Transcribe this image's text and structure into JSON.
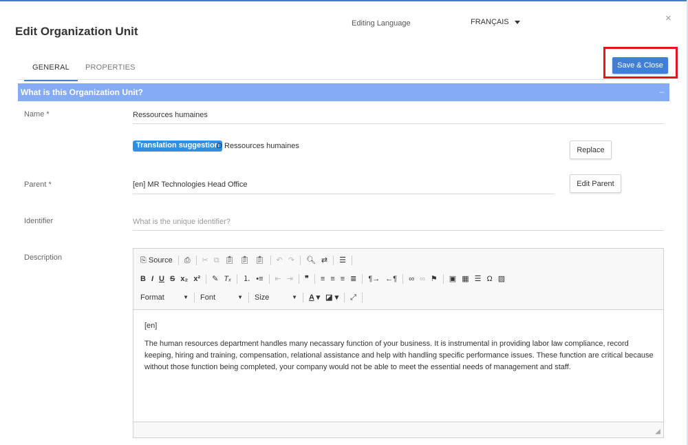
{
  "dialog": {
    "title": "Edit Organization Unit",
    "editing_language_label": "Editing Language",
    "language_value": "FRANÇAIS",
    "close_glyph": "×",
    "save_label": "Save & Close"
  },
  "tabs": [
    {
      "label": "GENERAL",
      "active": true
    },
    {
      "label": "PROPERTIES",
      "active": false
    }
  ],
  "section": {
    "title": "What is this Organization Unit?",
    "collapse_glyph": "–"
  },
  "fields": {
    "name": {
      "label": "Name *",
      "value": "Ressources humaines"
    },
    "translation": {
      "chip_label": "Translation suggestion",
      "value": "D Ressources humaines",
      "replace_label": "Replace"
    },
    "parent": {
      "label": "Parent *",
      "value": "[en] MR Technologies Head Office",
      "edit_label": "Edit Parent"
    },
    "identifier": {
      "label": "Identifier",
      "placeholder": "What is the unique identifier?"
    },
    "description": {
      "label": "Description"
    }
  },
  "editor": {
    "source_label": "Source",
    "format_label": "Format",
    "font_label": "Font",
    "size_label": "Size",
    "content": {
      "lang_tag": "[en]",
      "paragraph": "The human resources department handles many necassary function of your business. It is instrumental in providing labor law compliance, record keeping, hiring and training, compensation, relational assistance and help with handling specific performance issues. These function are critical because without those function being completed, your company would not be able to meet the essential needs of management and staff."
    }
  },
  "colors": {
    "accent": "#3f7fd8",
    "section_header": "#86abf6",
    "highlight": "#e3141b",
    "chip": "#2f8fe0"
  }
}
